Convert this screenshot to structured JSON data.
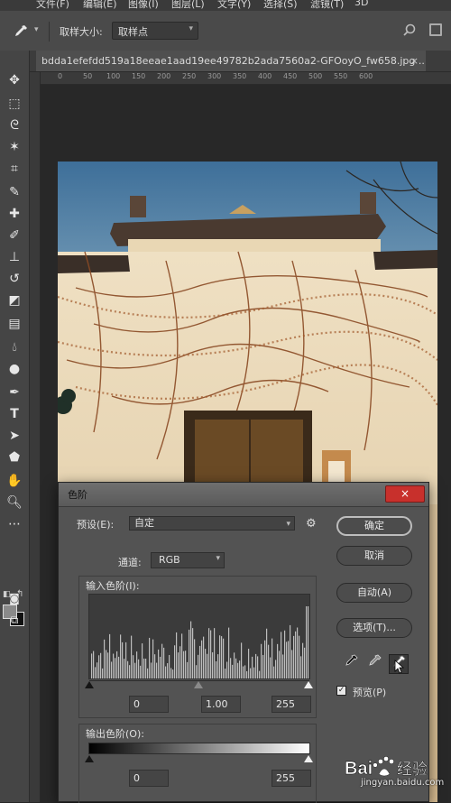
{
  "menu": {
    "items": [
      "文件(F)",
      "编辑(E)",
      "图像(I)",
      "图层(L)",
      "文字(Y)",
      "选择(S)",
      "滤镜(T)",
      "3D"
    ]
  },
  "options_bar": {
    "sample_size_label": "取样大小:",
    "sample_size_value": "取样点"
  },
  "document": {
    "tab_title": "bdda1efefdd519a18eeae1aad19ee49782b2ada7560a2-GFOoyO_fw658.jpg ...",
    "close": "×",
    "ruler_ticks": [
      "0",
      "50",
      "100",
      "150",
      "200",
      "250",
      "300",
      "350",
      "400",
      "450",
      "500",
      "550",
      "600"
    ]
  },
  "levels_dialog": {
    "title": "色阶",
    "close": "×",
    "preset_label": "预设(E):",
    "preset_value": "自定",
    "channel_label": "通道:",
    "channel_value": "RGB",
    "input_levels_label": "输入色阶(I):",
    "input_black": "0",
    "input_gamma": "1.00",
    "input_white": "255",
    "output_levels_label": "输出色阶(O):",
    "output_black": "0",
    "output_white": "255",
    "buttons": {
      "ok": "确定",
      "cancel": "取消",
      "auto": "自动(A)",
      "options": "选项(T)..."
    },
    "preview_label": "预览(P)",
    "preview_checked": true
  },
  "watermark": {
    "logo_text_a": "Bai",
    "logo_text_b": "经验",
    "site": "jingyan.baidu.com"
  },
  "colors": {
    "ui_dark": "#262626",
    "panel": "#535353",
    "close_red": "#c8302c"
  }
}
